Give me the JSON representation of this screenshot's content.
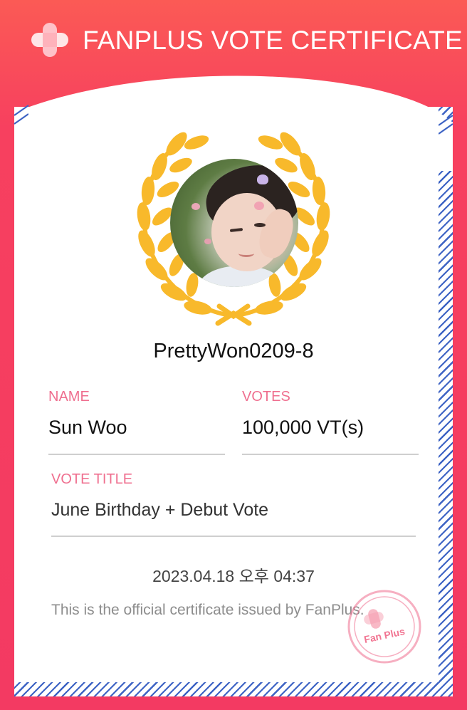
{
  "header": {
    "title": "FANPLUS VOTE CERTIFICATE",
    "logo_icon": "fanplus-logo-icon"
  },
  "colors": {
    "brand": "#f33a62",
    "label_pink": "#ef6f8f",
    "border_blue": "#3d63c4",
    "laurel_gold": "#f8b92b"
  },
  "certificate": {
    "nickname": "PrettyWon0209-8",
    "name_label": "NAME",
    "name_value": "Sun Woo",
    "votes_label": "VOTES",
    "votes_value": "100,000 VT(s)",
    "vote_title_label": "VOTE TITLE",
    "vote_title_value": "June Birthday + Debut Vote",
    "date": "2023.04.18 오후 04:37",
    "note": "This is the official certificate issued by FanPlus.",
    "stamp_text": "Fan Plus"
  }
}
